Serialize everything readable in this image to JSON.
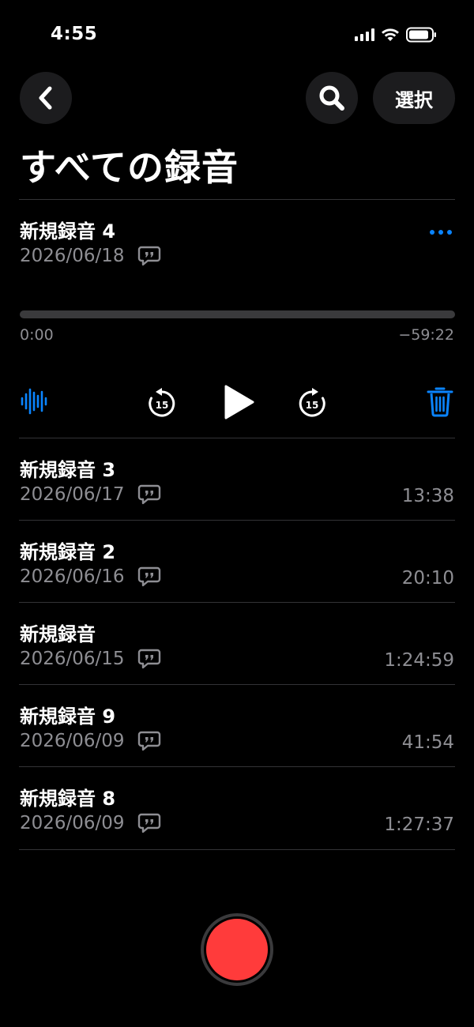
{
  "status_bar": {
    "time": "4:55",
    "icons": [
      "signal-icon",
      "wifi-icon",
      "battery-icon"
    ]
  },
  "nav": {
    "back_icon": "chevron-left-icon",
    "search_icon": "search-icon",
    "select_label": "選択"
  },
  "page_title": "すべての録音",
  "colors": {
    "background": "#000000",
    "accent": "#0a84ff",
    "secondary_text": "#8e8e93",
    "record": "#ff3b3b"
  },
  "expanded_recording": {
    "title": "新規録音 4",
    "date": "2026/06/18",
    "elapsed": "0:00",
    "remaining": "−59:22",
    "progress": 0,
    "skip_back_label": "15",
    "skip_forward_label": "15",
    "icons": [
      "waveform-icon",
      "skip-back-15-icon",
      "play-icon",
      "skip-forward-15-icon",
      "trash-icon",
      "more-icon"
    ]
  },
  "recordings": [
    {
      "title": "新規録音 3",
      "date": "2026/06/17",
      "duration": "13:38"
    },
    {
      "title": "新規録音 2",
      "date": "2026/06/16",
      "duration": "20:10"
    },
    {
      "title": "新規録音",
      "date": "2026/06/15",
      "duration": "1:24:59"
    },
    {
      "title": "新規録音 9",
      "date": "2026/06/09",
      "duration": "41:54"
    },
    {
      "title": "新規録音 8",
      "date": "2026/06/09",
      "duration": "1:27:37"
    }
  ]
}
